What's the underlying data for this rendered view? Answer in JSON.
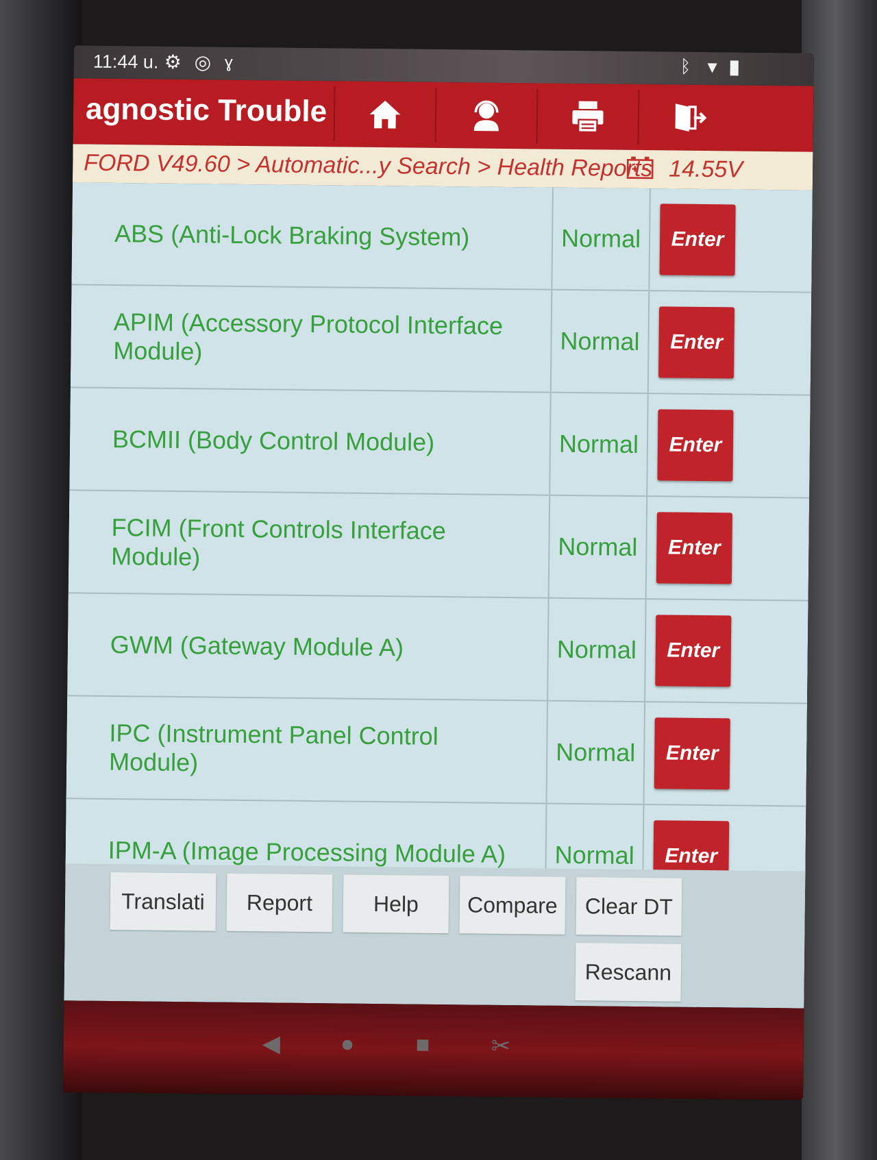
{
  "status_bar": {
    "time": "11:44 u.",
    "icons": [
      "gear-icon",
      "bluetooth-scan-icon",
      "stethoscope-icon",
      "bluetooth-icon",
      "wifi-icon",
      "battery-icon"
    ]
  },
  "app_bar": {
    "title": "agnostic Trouble",
    "buttons": [
      "home-icon",
      "support-agent-icon",
      "printer-icon",
      "exit-icon"
    ],
    "colors": {
      "header": "#b61c22",
      "accent_text": "#37a03d"
    }
  },
  "breadcrumb": {
    "path": "FORD V49.60 > Automatic...y Search > Health Reports",
    "voltage": "14.55V"
  },
  "modules": [
    {
      "name": "ABS (Anti-Lock Braking System)",
      "status": "Normal",
      "action": "Enter"
    },
    {
      "name": "APIM (Accessory Protocol Interface Module)",
      "status": "Normal",
      "action": "Enter"
    },
    {
      "name": "BCMII (Body Control Module)",
      "status": "Normal",
      "action": "Enter"
    },
    {
      "name": "FCIM (Front Controls Interface Module)",
      "status": "Normal",
      "action": "Enter"
    },
    {
      "name": "GWM (Gateway Module A)",
      "status": "Normal",
      "action": "Enter"
    },
    {
      "name": "IPC (Instrument Panel Control Module)",
      "status": "Normal",
      "action": "Enter"
    },
    {
      "name": "IPM-A (Image Processing Module A)",
      "status": "Normal",
      "action": "Enter"
    }
  ],
  "toolbar": {
    "translate": "Translati",
    "report": "Report",
    "help": "Help",
    "compare": "Compare",
    "clear_dtc": "Clear DT",
    "rescan": "Rescann"
  }
}
